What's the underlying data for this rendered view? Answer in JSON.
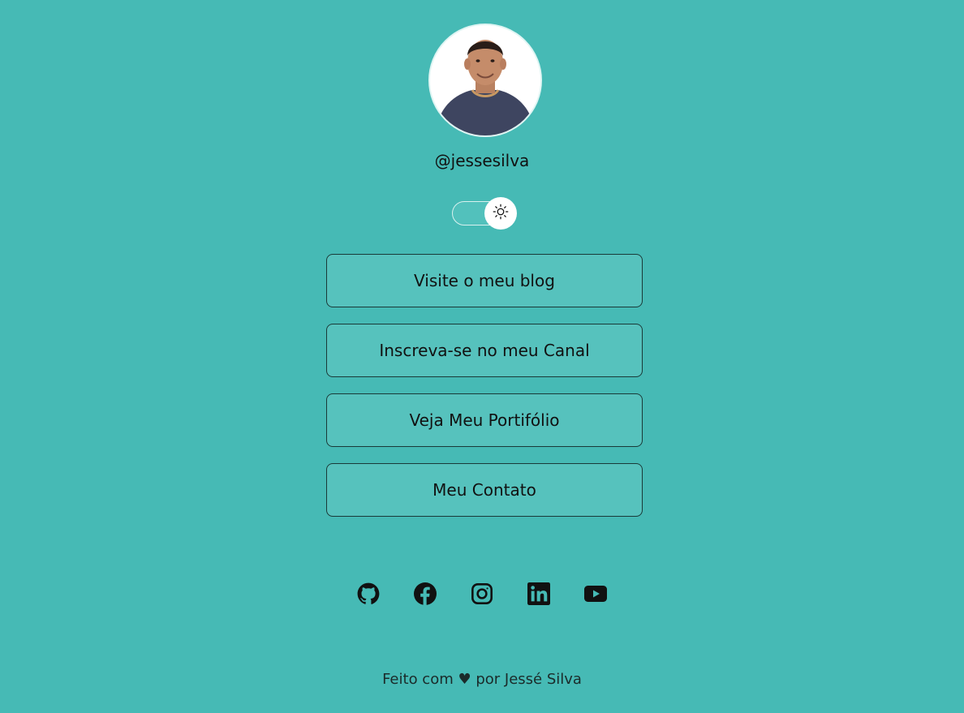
{
  "profile": {
    "username": "@jessesilva"
  },
  "theme_toggle": {
    "icon": "sun-icon",
    "state": "light"
  },
  "links": [
    {
      "label": "Visite o meu blog"
    },
    {
      "label": "Inscreva-se no meu Canal"
    },
    {
      "label": "Veja Meu Portifólio"
    },
    {
      "label": "Meu Contato"
    }
  ],
  "social": [
    {
      "icon": "github-icon"
    },
    {
      "icon": "facebook-icon"
    },
    {
      "icon": "instagram-icon"
    },
    {
      "icon": "linkedin-icon"
    },
    {
      "icon": "youtube-icon"
    }
  ],
  "footer": {
    "text": "Feito com ♥ por Jessé Silva"
  },
  "colors": {
    "background": "#46bab5",
    "button_bg": "#56c2bd",
    "text": "#111111"
  }
}
